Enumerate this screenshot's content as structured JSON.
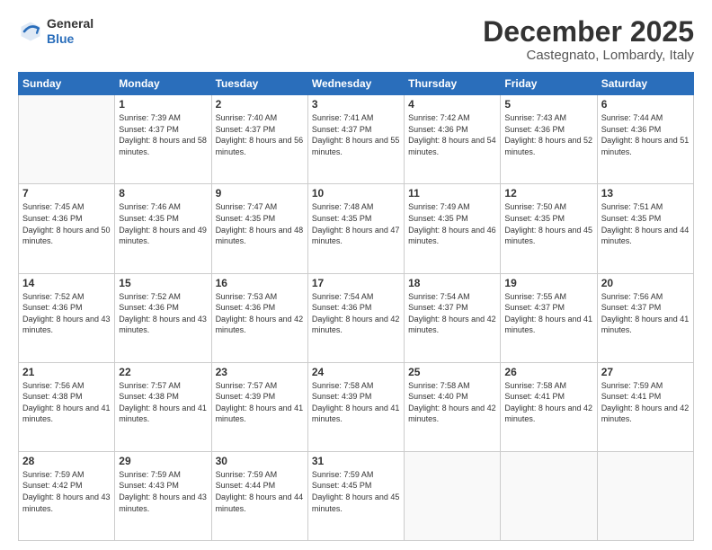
{
  "logo": {
    "general": "General",
    "blue": "Blue"
  },
  "header": {
    "month": "December 2025",
    "location": "Castegnato, Lombardy, Italy"
  },
  "days_of_week": [
    "Sunday",
    "Monday",
    "Tuesday",
    "Wednesday",
    "Thursday",
    "Friday",
    "Saturday"
  ],
  "weeks": [
    [
      {
        "day": "",
        "sunrise": "",
        "sunset": "",
        "daylight": ""
      },
      {
        "day": "1",
        "sunrise": "Sunrise: 7:39 AM",
        "sunset": "Sunset: 4:37 PM",
        "daylight": "Daylight: 8 hours and 58 minutes."
      },
      {
        "day": "2",
        "sunrise": "Sunrise: 7:40 AM",
        "sunset": "Sunset: 4:37 PM",
        "daylight": "Daylight: 8 hours and 56 minutes."
      },
      {
        "day": "3",
        "sunrise": "Sunrise: 7:41 AM",
        "sunset": "Sunset: 4:37 PM",
        "daylight": "Daylight: 8 hours and 55 minutes."
      },
      {
        "day": "4",
        "sunrise": "Sunrise: 7:42 AM",
        "sunset": "Sunset: 4:36 PM",
        "daylight": "Daylight: 8 hours and 54 minutes."
      },
      {
        "day": "5",
        "sunrise": "Sunrise: 7:43 AM",
        "sunset": "Sunset: 4:36 PM",
        "daylight": "Daylight: 8 hours and 52 minutes."
      },
      {
        "day": "6",
        "sunrise": "Sunrise: 7:44 AM",
        "sunset": "Sunset: 4:36 PM",
        "daylight": "Daylight: 8 hours and 51 minutes."
      }
    ],
    [
      {
        "day": "7",
        "sunrise": "Sunrise: 7:45 AM",
        "sunset": "Sunset: 4:36 PM",
        "daylight": "Daylight: 8 hours and 50 minutes."
      },
      {
        "day": "8",
        "sunrise": "Sunrise: 7:46 AM",
        "sunset": "Sunset: 4:35 PM",
        "daylight": "Daylight: 8 hours and 49 minutes."
      },
      {
        "day": "9",
        "sunrise": "Sunrise: 7:47 AM",
        "sunset": "Sunset: 4:35 PM",
        "daylight": "Daylight: 8 hours and 48 minutes."
      },
      {
        "day": "10",
        "sunrise": "Sunrise: 7:48 AM",
        "sunset": "Sunset: 4:35 PM",
        "daylight": "Daylight: 8 hours and 47 minutes."
      },
      {
        "day": "11",
        "sunrise": "Sunrise: 7:49 AM",
        "sunset": "Sunset: 4:35 PM",
        "daylight": "Daylight: 8 hours and 46 minutes."
      },
      {
        "day": "12",
        "sunrise": "Sunrise: 7:50 AM",
        "sunset": "Sunset: 4:35 PM",
        "daylight": "Daylight: 8 hours and 45 minutes."
      },
      {
        "day": "13",
        "sunrise": "Sunrise: 7:51 AM",
        "sunset": "Sunset: 4:35 PM",
        "daylight": "Daylight: 8 hours and 44 minutes."
      }
    ],
    [
      {
        "day": "14",
        "sunrise": "Sunrise: 7:52 AM",
        "sunset": "Sunset: 4:36 PM",
        "daylight": "Daylight: 8 hours and 43 minutes."
      },
      {
        "day": "15",
        "sunrise": "Sunrise: 7:52 AM",
        "sunset": "Sunset: 4:36 PM",
        "daylight": "Daylight: 8 hours and 43 minutes."
      },
      {
        "day": "16",
        "sunrise": "Sunrise: 7:53 AM",
        "sunset": "Sunset: 4:36 PM",
        "daylight": "Daylight: 8 hours and 42 minutes."
      },
      {
        "day": "17",
        "sunrise": "Sunrise: 7:54 AM",
        "sunset": "Sunset: 4:36 PM",
        "daylight": "Daylight: 8 hours and 42 minutes."
      },
      {
        "day": "18",
        "sunrise": "Sunrise: 7:54 AM",
        "sunset": "Sunset: 4:37 PM",
        "daylight": "Daylight: 8 hours and 42 minutes."
      },
      {
        "day": "19",
        "sunrise": "Sunrise: 7:55 AM",
        "sunset": "Sunset: 4:37 PM",
        "daylight": "Daylight: 8 hours and 41 minutes."
      },
      {
        "day": "20",
        "sunrise": "Sunrise: 7:56 AM",
        "sunset": "Sunset: 4:37 PM",
        "daylight": "Daylight: 8 hours and 41 minutes."
      }
    ],
    [
      {
        "day": "21",
        "sunrise": "Sunrise: 7:56 AM",
        "sunset": "Sunset: 4:38 PM",
        "daylight": "Daylight: 8 hours and 41 minutes."
      },
      {
        "day": "22",
        "sunrise": "Sunrise: 7:57 AM",
        "sunset": "Sunset: 4:38 PM",
        "daylight": "Daylight: 8 hours and 41 minutes."
      },
      {
        "day": "23",
        "sunrise": "Sunrise: 7:57 AM",
        "sunset": "Sunset: 4:39 PM",
        "daylight": "Daylight: 8 hours and 41 minutes."
      },
      {
        "day": "24",
        "sunrise": "Sunrise: 7:58 AM",
        "sunset": "Sunset: 4:39 PM",
        "daylight": "Daylight: 8 hours and 41 minutes."
      },
      {
        "day": "25",
        "sunrise": "Sunrise: 7:58 AM",
        "sunset": "Sunset: 4:40 PM",
        "daylight": "Daylight: 8 hours and 42 minutes."
      },
      {
        "day": "26",
        "sunrise": "Sunrise: 7:58 AM",
        "sunset": "Sunset: 4:41 PM",
        "daylight": "Daylight: 8 hours and 42 minutes."
      },
      {
        "day": "27",
        "sunrise": "Sunrise: 7:59 AM",
        "sunset": "Sunset: 4:41 PM",
        "daylight": "Daylight: 8 hours and 42 minutes."
      }
    ],
    [
      {
        "day": "28",
        "sunrise": "Sunrise: 7:59 AM",
        "sunset": "Sunset: 4:42 PM",
        "daylight": "Daylight: 8 hours and 43 minutes."
      },
      {
        "day": "29",
        "sunrise": "Sunrise: 7:59 AM",
        "sunset": "Sunset: 4:43 PM",
        "daylight": "Daylight: 8 hours and 43 minutes."
      },
      {
        "day": "30",
        "sunrise": "Sunrise: 7:59 AM",
        "sunset": "Sunset: 4:44 PM",
        "daylight": "Daylight: 8 hours and 44 minutes."
      },
      {
        "day": "31",
        "sunrise": "Sunrise: 7:59 AM",
        "sunset": "Sunset: 4:45 PM",
        "daylight": "Daylight: 8 hours and 45 minutes."
      },
      {
        "day": "",
        "sunrise": "",
        "sunset": "",
        "daylight": ""
      },
      {
        "day": "",
        "sunrise": "",
        "sunset": "",
        "daylight": ""
      },
      {
        "day": "",
        "sunrise": "",
        "sunset": "",
        "daylight": ""
      }
    ]
  ]
}
